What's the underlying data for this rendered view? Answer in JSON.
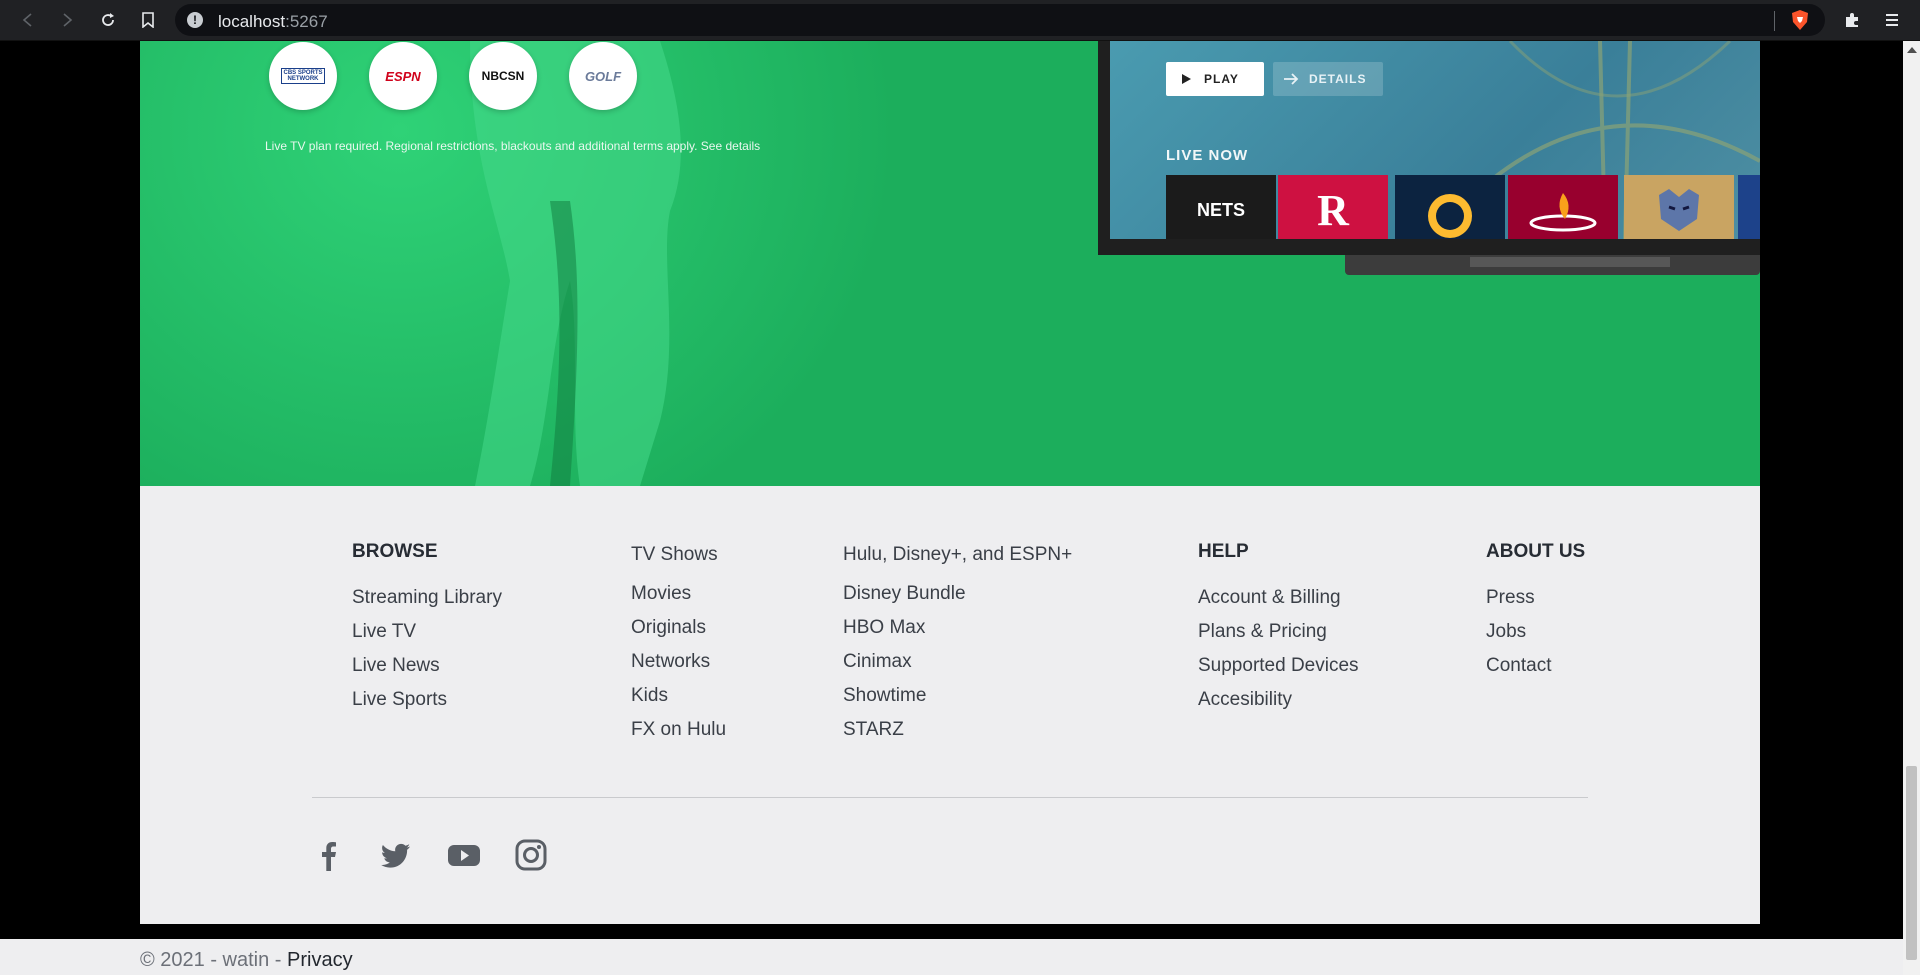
{
  "browser": {
    "url_host": "localhost",
    "url_port": ":5267"
  },
  "hero": {
    "networks": [
      {
        "name": "CBS SPORTS NETWORK",
        "color": "#1a3f8a"
      },
      {
        "name": "ESPN",
        "color": "#d0021b"
      },
      {
        "name": "NBCSN",
        "color": "#111111"
      },
      {
        "name": "GOLF",
        "color": "#6b7b9a"
      }
    ],
    "disclaimer": "Live TV plan required. Regional restrictions, blackouts and additional terms apply. See details",
    "tv": {
      "play_label": "PLAY",
      "details_label": "DETAILS",
      "live_now_label": "LIVE NOW",
      "teams": [
        {
          "name": "NETS",
          "color": "#1b1b1b"
        },
        {
          "name": "R",
          "color": "#ce1141"
        },
        {
          "name": "",
          "color": "#0c2340"
        },
        {
          "name": "",
          "color": "#98002e"
        },
        {
          "name": "",
          "color": "#5d76a9"
        }
      ]
    }
  },
  "footer": {
    "columns": [
      {
        "heading": "BROWSE",
        "items": [
          "Streaming Library",
          "Live TV",
          "Live News",
          "Live Sports"
        ]
      },
      {
        "heading": "",
        "items": [
          "TV Shows",
          "Movies",
          "Originals",
          "Networks",
          "Kids",
          "FX on Hulu"
        ]
      },
      {
        "heading": "",
        "items": [
          "Hulu, Disney+, and ESPN+",
          "Disney Bundle",
          "HBO Max",
          "Cinimax",
          "Showtime",
          "STARZ"
        ]
      },
      {
        "heading": "HELP",
        "items": [
          "Account & Billing",
          "Plans & Pricing",
          "Supported Devices",
          "Accesibility"
        ]
      },
      {
        "heading": "ABOUT US",
        "items": [
          "Press",
          "Jobs",
          "Contact"
        ]
      }
    ],
    "social": [
      "facebook-icon",
      "twitter-icon",
      "youtube-icon",
      "instagram-icon"
    ]
  },
  "bottom": {
    "copyright": "© 2021 - watin - ",
    "privacy": "Privacy"
  },
  "colors": {
    "hero_green": "#1cae5c",
    "footer_bg": "#eeeef0"
  }
}
